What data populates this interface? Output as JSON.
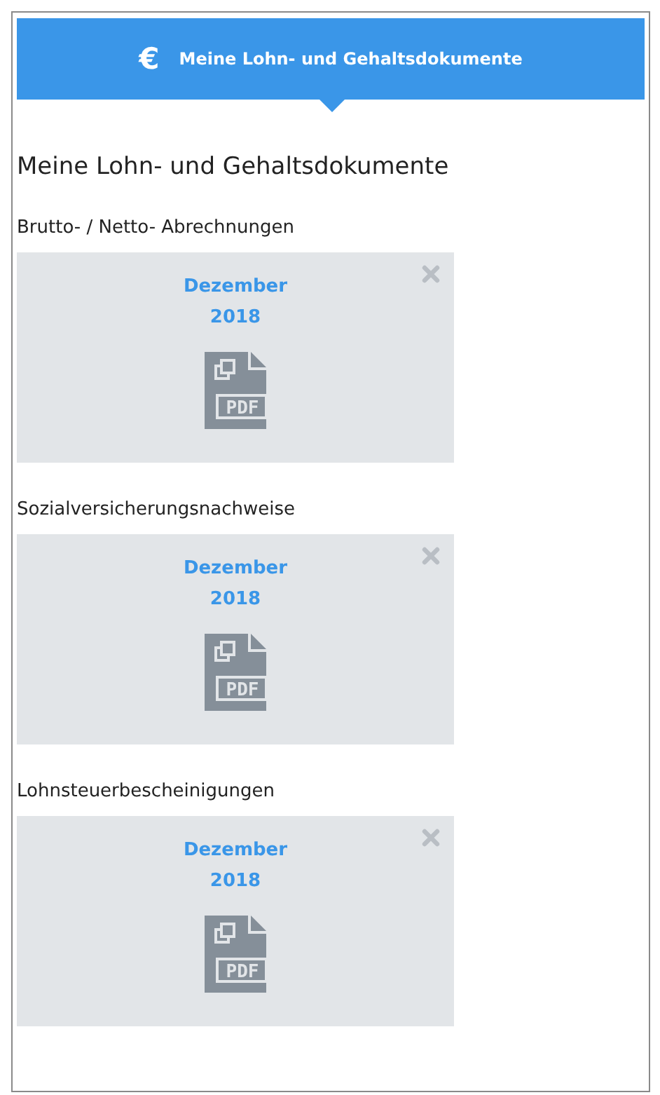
{
  "banner": {
    "icon": "€",
    "title": "Meine Lohn- und Gehaltsdokumente"
  },
  "heading": "Meine Lohn- und Gehaltsdokumente",
  "sections": [
    {
      "label": "Brutto- / Netto- Abrechnungen",
      "document": {
        "month": "Dezember",
        "year": "2018",
        "file_type": "PDF"
      }
    },
    {
      "label": "Sozialversicherungsnachweise",
      "document": {
        "month": "Dezember",
        "year": "2018",
        "file_type": "PDF"
      }
    },
    {
      "label": "Lohnsteuerbescheinigungen",
      "document": {
        "month": "Dezember",
        "year": "2018",
        "file_type": "PDF"
      }
    }
  ]
}
